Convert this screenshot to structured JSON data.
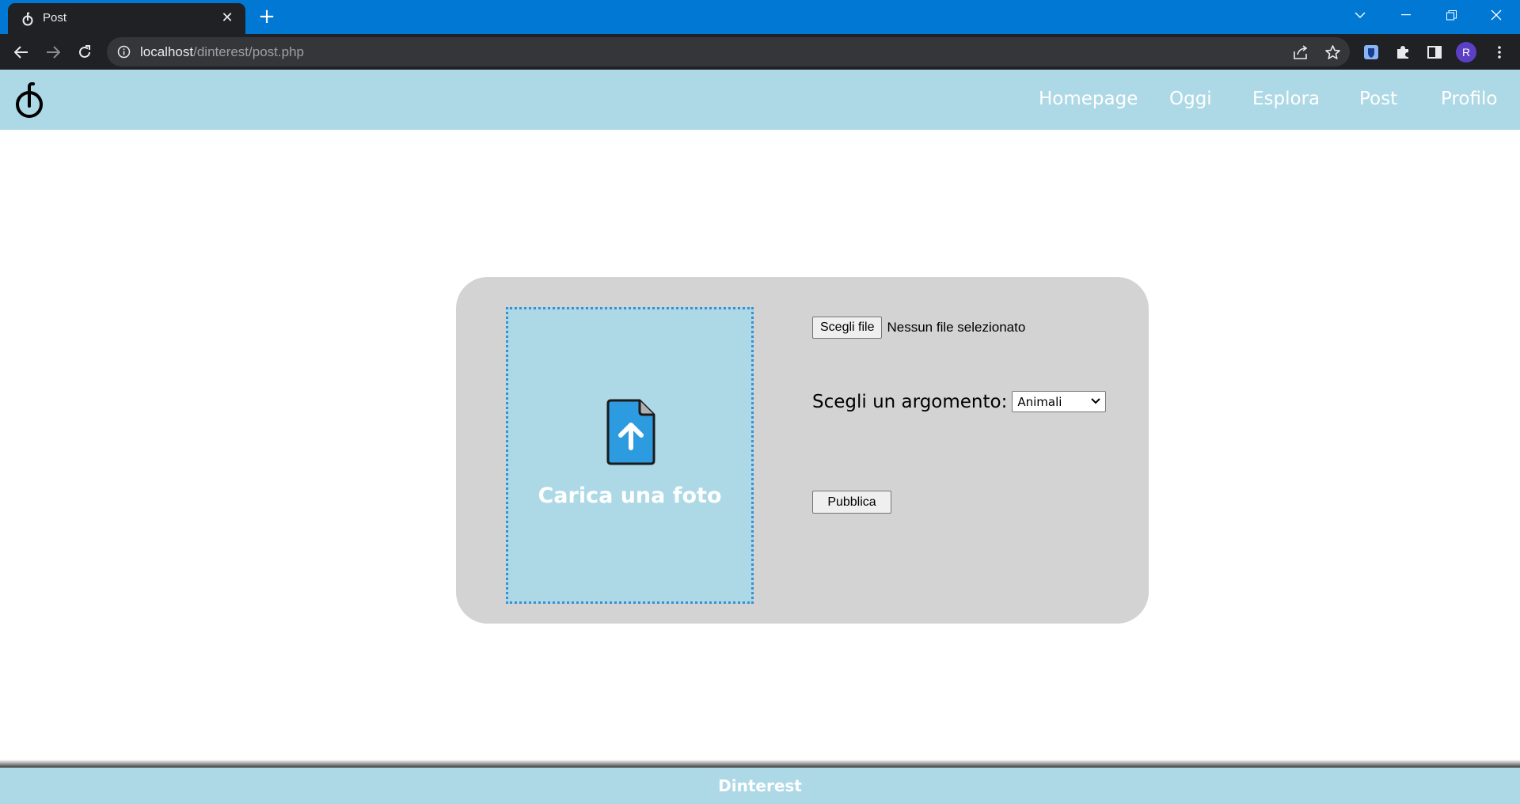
{
  "browser": {
    "tab_title": "Post",
    "new_tab_symbol": "+",
    "url_host": "localhost",
    "url_path": "/dinterest/post.php",
    "profile_initial": "R",
    "accent_color": "#0078d4"
  },
  "site": {
    "logo_icon": "dinterest-logo",
    "nav": [
      {
        "label": "Homepage"
      },
      {
        "label": "Oggi"
      },
      {
        "label": "Esplora"
      },
      {
        "label": "Post"
      },
      {
        "label": "Profilo"
      }
    ],
    "header_color": "#add8e6"
  },
  "upload": {
    "icon": "upload-file-icon",
    "label": "Carica una foto"
  },
  "form": {
    "file_button_label": "Scegli file",
    "file_status": "Nessun file selezionato",
    "topic_label": "Scegli un argomento:",
    "topic_selected": "Animali",
    "publish_label": "Pubblica"
  },
  "footer": {
    "text": "Dinterest"
  }
}
